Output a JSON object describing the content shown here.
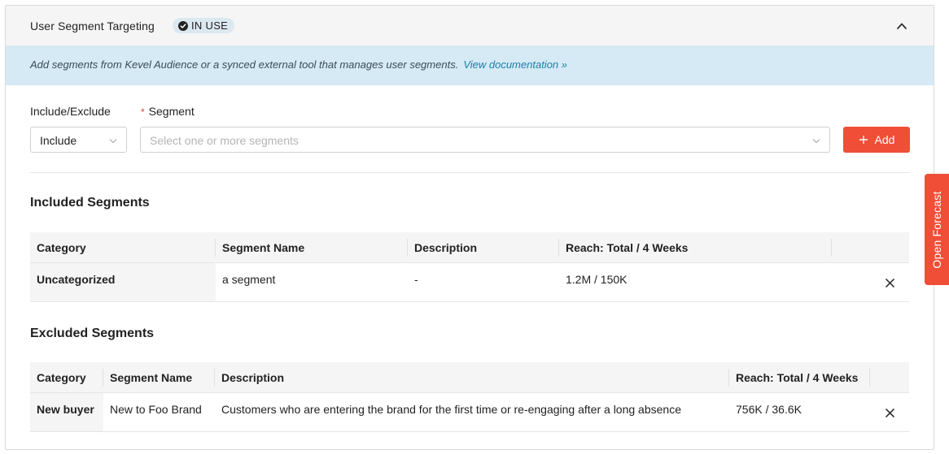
{
  "header": {
    "title": "User Segment Targeting",
    "badge": "IN USE"
  },
  "banner": {
    "text": "Add segments from Kevel Audience or a synced external tool that manages user segments.",
    "link": "View documentation »"
  },
  "form": {
    "include_label": "Include/Exclude",
    "include_value": "Include",
    "segment_required": "*",
    "segment_label": "Segment",
    "segment_placeholder": "Select one or more segments",
    "add_label": "Add"
  },
  "included": {
    "title": "Included Segments",
    "columns": [
      "Category",
      "Segment Name",
      "Description",
      "Reach: Total / 4 Weeks"
    ],
    "rows": [
      {
        "category": "Uncategorized",
        "name": "a segment",
        "description": "-",
        "reach": "1.2M / 150K"
      }
    ]
  },
  "excluded": {
    "title": "Excluded Segments",
    "columns": [
      "Category",
      "Segment Name",
      "Description",
      "Reach: Total / 4 Weeks"
    ],
    "rows": [
      {
        "category": "New buyer",
        "name": "New to Foo Brand",
        "description": "Customers who are entering the brand for the first time or re-engaging after a long absence",
        "reach": "756K / 36.6K"
      }
    ]
  },
  "side_tab": {
    "label": "Open Forecast"
  },
  "colors": {
    "accent": "#f04e37",
    "banner_bg": "#d6eaf5",
    "link": "#1a7fa8",
    "badge_bg": "#dce8f0"
  },
  "icons": [
    "check-circle-icon",
    "chevron-up-icon",
    "chevron-down-icon",
    "plus-icon",
    "close-icon"
  ]
}
